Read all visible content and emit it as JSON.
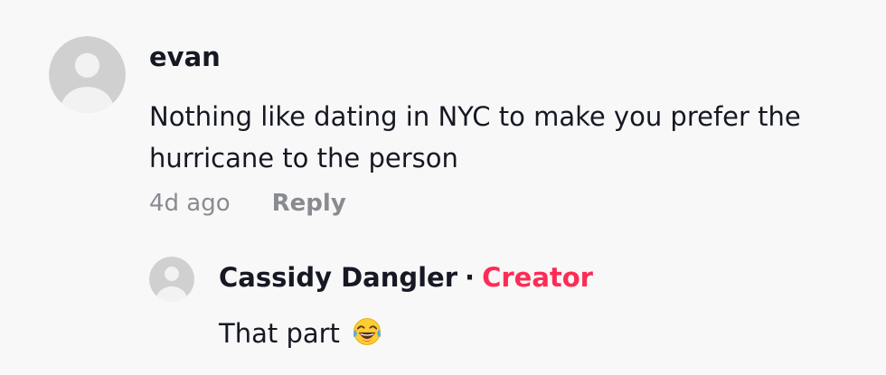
{
  "comment": {
    "username": "evan",
    "text": "Nothing like dating in NYC to make you prefer the hurricane to the person",
    "timestamp": "4d ago",
    "reply_label": "Reply",
    "avatar_icon": "default-user-avatar-icon"
  },
  "reply": {
    "username": "Cassidy Dangler",
    "separator": "·",
    "badge": "Creator",
    "text": "That part",
    "emoji_icon": "face-with-tears-of-joy-icon",
    "avatar_icon": "default-user-avatar-icon"
  },
  "colors": {
    "background": "#f8f8f8",
    "primary_text": "#161823",
    "secondary_text": "#8a8b91",
    "creator_badge": "#fe2c55",
    "avatar_bg": "#d0d0d0",
    "avatar_fg": "#f2f2f2"
  }
}
